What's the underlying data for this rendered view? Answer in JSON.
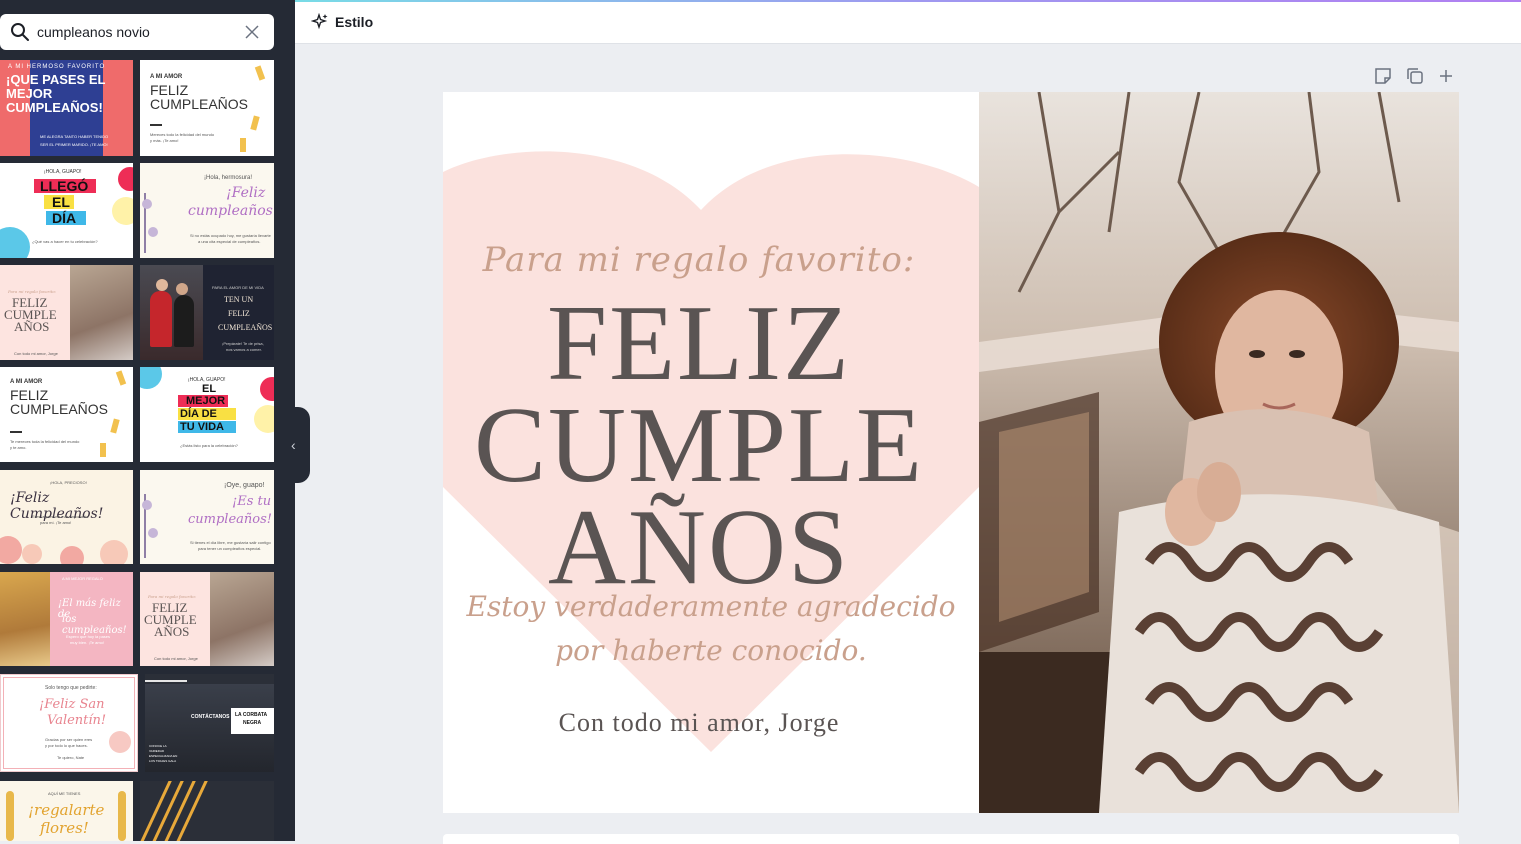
{
  "search": {
    "value": "cumpleanos novio",
    "placeholder": ""
  },
  "topbar": {
    "style_label": "Estilo"
  },
  "templates": [
    {
      "id": "t1",
      "lines": [
        "A MI HERMOSO FAVORITO",
        "¡QUE PASES EL",
        "MEJOR",
        "CUMPLEAÑOS!",
        "ME ALEGRA TANTO HABER TENIDO",
        "SER EL PRIMER MARIDO. ¡TE AMO!"
      ]
    },
    {
      "id": "t2",
      "lines": [
        "A MI AMOR",
        "FELIZ",
        "CUMPLEAÑOS",
        "Mereces todo la felicidad del mundo",
        "y más. ¡Te amo!"
      ]
    },
    {
      "id": "t3",
      "lines": [
        "¡HOLA, GUAPO!",
        "LLEGÓ",
        "EL",
        "DÍA",
        "¿Qué vas a hacer en tu celebración?"
      ]
    },
    {
      "id": "t4",
      "lines": [
        "¡Hola, hermosura!",
        "¡Feliz",
        "cumpleaños!",
        "Si no estás ocupado hoy, me gustaría llevarte",
        "a una cita especial de cumpleaños."
      ]
    },
    {
      "id": "t5",
      "lines": [
        "Para mi regalo favorito:",
        "FELIZ",
        "CUMPLE",
        "AÑOS",
        "Con todo mi amor, Jorge"
      ]
    },
    {
      "id": "t6",
      "lines": [
        "PARA EL AMOR DE MI VIDA",
        "TEN UN",
        "FELIZ",
        "CUMPLEAÑOS",
        "¡Prepárate! Te de prisa,",
        "nos vamos a comer."
      ]
    },
    {
      "id": "t7",
      "lines": [
        "A MI AMOR",
        "FELIZ",
        "CUMPLEAÑOS",
        "Te mereces toda la felicidad del mundo",
        "y te amo."
      ]
    },
    {
      "id": "t8",
      "lines": [
        "¡HOLA, GUAPO!",
        "EL",
        "MEJOR",
        "DÍA DE",
        "TU VIDA",
        "¿Estás listo para la celebración?"
      ]
    },
    {
      "id": "t9",
      "lines": [
        "¡HOLA, PRECIOSO!",
        "¡Feliz Cumpleaños!",
        "Eres la persona más importante",
        "para mí. ¡Te amo!"
      ]
    },
    {
      "id": "t10",
      "lines": [
        "¡Oye, guapo!",
        "¡Es tu",
        "cumpleaños!",
        "Si tienes el día libre, me gustaría salir contigo",
        "para tener un cumpleaños especial."
      ]
    },
    {
      "id": "t11",
      "lines": [
        "A MI MEJOR REGALO",
        "¡El más feliz de",
        "los cumpleaños!",
        "Espero que hoy la pases",
        "muy bien. ¡Te amo!"
      ]
    },
    {
      "id": "t12",
      "lines": [
        "Para mi regalo favorito:",
        "FELIZ",
        "CUMPLE",
        "AÑOS",
        "Con todo mi amor, Jorge"
      ]
    },
    {
      "id": "t13",
      "lines": [
        "Solo tengo que pedirte:",
        "¡Feliz San",
        "Valentín!",
        "Gracias por ser quien eres",
        "y por todo lo que haces.",
        "Te quiero, Nate"
      ]
    },
    {
      "id": "t14",
      "lines": [
        "CONTÁCTANOS",
        "LA CORBATA",
        "NEGRA",
        "CONOCE LA",
        "VARIEDAD",
        "ESPECIALIZADA EN",
        "LOS TRAJES GALA"
      ]
    },
    {
      "id": "t15",
      "lines": [
        "AQUÍ ME TIENES",
        "¡regalarte",
        "flores!"
      ]
    },
    {
      "id": "t16",
      "lines": []
    }
  ],
  "design": {
    "top_script": "Para mi regalo favorito:",
    "line1": "FELIZ",
    "line2": "CUMPLE",
    "line3": "AÑOS",
    "sub_script_1": "Estoy verdaderamente agradecido",
    "sub_script_2": "por haberte conocido.",
    "signature": "Con todo mi amor, Jorge"
  },
  "colors": {
    "sidebar": "#252a35",
    "heart": "#fbe2de",
    "heading": "#5a5453",
    "script": "#c9a08c"
  },
  "icons": [
    "search-icon",
    "clear-icon",
    "magic-style-icon",
    "notes-icon",
    "duplicate-page-icon",
    "add-page-icon",
    "chevron-left-icon"
  ]
}
